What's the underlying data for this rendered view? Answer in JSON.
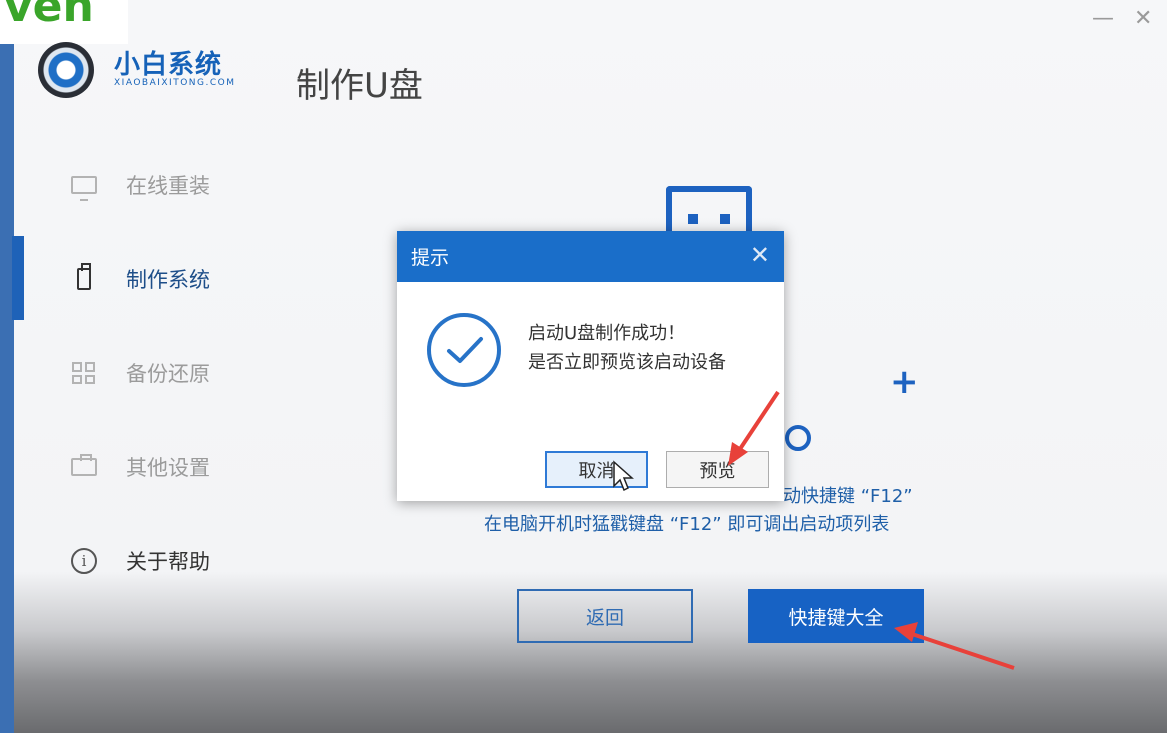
{
  "corner_logo_text": "ven",
  "brand": {
    "name": "小白系统",
    "subtitle": "XIAOBAIXITONG.COM"
  },
  "page_title": "制作U盘",
  "window_controls": {
    "minimize": "—",
    "close": "✕"
  },
  "sidebar": {
    "items": [
      {
        "label": "在线重装",
        "icon": "monitor-icon",
        "active": false
      },
      {
        "label": "制作系统",
        "icon": "usb-icon",
        "active": true
      },
      {
        "label": "备份还原",
        "icon": "grid-icon",
        "active": false
      },
      {
        "label": "其他设置",
        "icon": "briefcase-icon",
        "active": false
      },
      {
        "label": "关于帮助",
        "icon": "info-icon",
        "active": false
      }
    ]
  },
  "main": {
    "hint_line_1": "动快捷键 “F12”",
    "hint_line_2": "在电脑开机时猛戳键盘 “F12” 即可调出启动项列表",
    "back_button": "返回",
    "hotkeys_button": "快捷键大全"
  },
  "dialog": {
    "title": "提示",
    "close": "✕",
    "message_line_1": "启动U盘制作成功！",
    "message_line_2": "是否立即预览该启动设备",
    "cancel_button": "取消",
    "preview_button": "预览"
  },
  "colors": {
    "accent": "#1a6ec9",
    "annotation_arrow": "#e8413a"
  }
}
